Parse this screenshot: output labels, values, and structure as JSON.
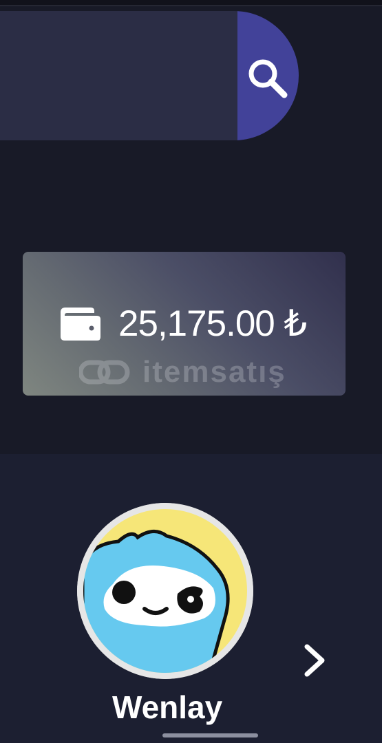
{
  "search": {
    "value": "",
    "placeholder": "",
    "button_icon": "search-icon",
    "button_color": "#424299",
    "field_color": "#2b2d45"
  },
  "wallet": {
    "icon": "wallet-icon",
    "balance": "25,175.00 ₺"
  },
  "watermark": {
    "text": "itemsatış"
  },
  "profile": {
    "username": "Wenlay",
    "avatar_icon": "avatar-icon",
    "next_icon": "chevron-right-icon"
  },
  "colors": {
    "background": "#181a27",
    "panel": "#1c1f31",
    "card_start": "#31304d",
    "card_end": "#7f8680",
    "text": "#ffffff"
  }
}
